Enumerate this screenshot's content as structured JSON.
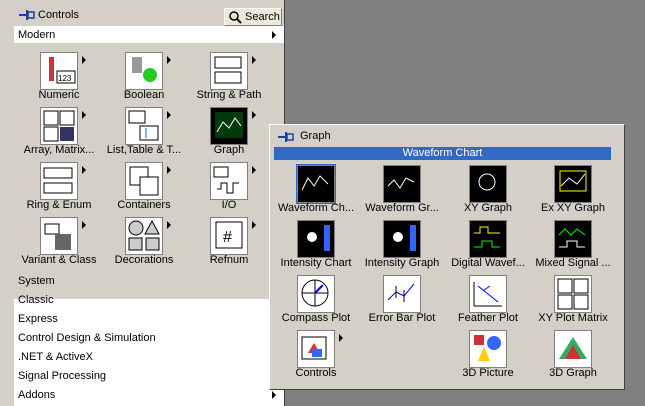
{
  "controls_palette": {
    "title": "Controls",
    "search_label": "Search",
    "modern_label": "Modern",
    "modern_items": [
      {
        "label": "Numeric",
        "icon": "numeric-icon"
      },
      {
        "label": "Boolean",
        "icon": "boolean-icon"
      },
      {
        "label": "String & Path",
        "icon": "string-path-icon"
      },
      {
        "label": "Array, Matrix...",
        "icon": "array-matrix-icon"
      },
      {
        "label": "List,Table & T...",
        "icon": "list-table-icon"
      },
      {
        "label": "Graph",
        "icon": "graph-icon"
      },
      {
        "label": "Ring & Enum",
        "icon": "ring-enum-icon"
      },
      {
        "label": "Containers",
        "icon": "containers-icon"
      },
      {
        "label": "I/O",
        "icon": "io-icon"
      },
      {
        "label": "Variant & Class",
        "icon": "variant-class-icon"
      },
      {
        "label": "Decorations",
        "icon": "decorations-icon"
      },
      {
        "label": "Refnum",
        "icon": "refnum-icon"
      }
    ],
    "categories": [
      "System",
      "Classic",
      "Express",
      "Control Design & Simulation",
      ".NET & ActiveX",
      "Signal Processing",
      "Addons"
    ]
  },
  "graph_palette": {
    "title": "Graph",
    "highlighted": "Waveform Chart",
    "items": [
      {
        "label": "Waveform Ch...",
        "icon": "waveform-chart-icon"
      },
      {
        "label": "Waveform Gr...",
        "icon": "waveform-graph-icon"
      },
      {
        "label": "XY Graph",
        "icon": "xy-graph-icon"
      },
      {
        "label": "Ex XY Graph",
        "icon": "ex-xy-graph-icon"
      },
      {
        "label": "Intensity Chart",
        "icon": "intensity-chart-icon"
      },
      {
        "label": "Intensity Graph",
        "icon": "intensity-graph-icon"
      },
      {
        "label": "Digital Wavef...",
        "icon": "digital-waveform-icon"
      },
      {
        "label": "Mixed Signal ...",
        "icon": "mixed-signal-icon"
      },
      {
        "label": "Compass Plot",
        "icon": "compass-plot-icon"
      },
      {
        "label": "Error Bar Plot",
        "icon": "error-bar-plot-icon"
      },
      {
        "label": "Feather Plot",
        "icon": "feather-plot-icon"
      },
      {
        "label": "XY Plot Matrix",
        "icon": "xy-plot-matrix-icon"
      },
      {
        "label": "Controls",
        "icon": "controls-icon"
      },
      {
        "label": "3D Picture",
        "icon": "3d-picture-icon"
      },
      {
        "label": "3D Graph",
        "icon": "3d-graph-icon"
      }
    ]
  }
}
